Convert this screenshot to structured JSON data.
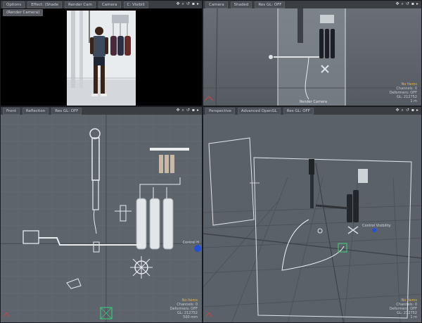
{
  "viewports": {
    "camera_render": {
      "tabs": [
        "Options",
        "Effect: (Shade",
        "Render Cam",
        "Camera",
        "C: Visibili"
      ],
      "sub_tabs": [
        "(Render Camera)"
      ],
      "tools": [
        "✥",
        "⌕",
        "↺",
        "▪",
        "▸"
      ]
    },
    "camera_view": {
      "tabs": [
        "Camera",
        "Shaded",
        "Res GL: OFF"
      ],
      "tools": [
        "✥",
        "⌕",
        "↺",
        "▪",
        "▸"
      ],
      "label": "Render Camera",
      "info": {
        "status": "No Items",
        "channels": "Channels: 0",
        "deformers": "Deformers: OFF",
        "gl": "GL: 212752",
        "scale": "1 m"
      }
    },
    "front_view": {
      "tabs": [
        "Front",
        "Reflection",
        "Res GL: OFF"
      ],
      "tools": [
        "✥",
        "⌕",
        "↺",
        "▪",
        "▸"
      ],
      "side_label": "Control H",
      "info": {
        "status": "No Items",
        "channels": "Channels: 0",
        "deformers": "Deformers: OFF",
        "gl": "GL: 212752",
        "scale": "500 mm"
      }
    },
    "perspective_view": {
      "tabs": [
        "Perspective",
        "Advanced OpenGL",
        "Res GL: OFF"
      ],
      "tools": [
        "✥",
        "⌕",
        "↺",
        "▪",
        "▸"
      ],
      "control_label": "Control Visibility",
      "info": {
        "status": "No Items",
        "channels": "Channels: 0",
        "deformers": "Deformers: OFF",
        "gl": "GL: 212752",
        "scale": "1 m"
      }
    }
  },
  "colors": {
    "status_highlight": "#f2b632",
    "control_dot": "#2450d8",
    "viewport_bg": "#5a6068"
  }
}
